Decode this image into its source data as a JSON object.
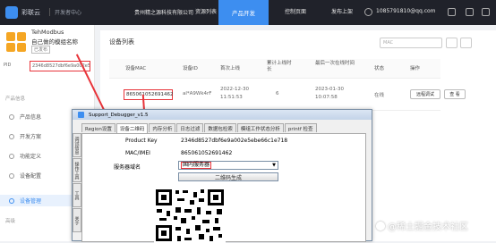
{
  "topbar": {
    "brand": "彩联云",
    "brand_sub": "开发者中心",
    "company": "贵州精之源科技有限公司",
    "company_nav": "资源列表",
    "nav_active": "产品开发",
    "nav_console": "控制页面",
    "nav_market": "发布上架",
    "user": "1085791810@qq.com"
  },
  "sidebar": {
    "product_name": "TehModbus",
    "product_name2": "自己做的模组名称",
    "product_tag": "已发布",
    "pid_label": "PID",
    "pid_value": "2346d8527dbf6e9a002e5ebe66c1e718",
    "group1": "产品信息",
    "items": [
      {
        "label": "产品信息"
      },
      {
        "label": "开发方案"
      },
      {
        "label": "功能定义"
      },
      {
        "label": "设备配置"
      },
      {
        "label": "设备管理"
      }
    ],
    "group2": "高级"
  },
  "main": {
    "title": "设备列表",
    "search_placeholder": "MAC",
    "columns": [
      "设备MAC",
      "设备ID",
      "首次上线",
      "累计上线时长",
      "最后一次在线时间",
      "状态",
      "操作"
    ],
    "row": {
      "mac": "865061052691462",
      "id": "al*A9Wk4rF",
      "first_online_date": "2022-12-30",
      "first_online_time": "11:51:53",
      "duration": "6",
      "last_online_date": "2023-01-30",
      "last_online_time": "10:07:58",
      "status": "在线",
      "btn_debug": "远程调试",
      "btn_detail": "查 看"
    }
  },
  "window": {
    "title": "Support_Debugger_v1.5",
    "tabs": [
      "Region设置",
      "设备二维码",
      "内存分析",
      "日志过滤",
      "数据包检索",
      "模组工作状态分析",
      "printf 检查"
    ],
    "active_tab": "设备二维码",
    "vtabs": [
      "调试信息",
      "操作工具",
      "工具",
      "关于"
    ],
    "product_key_label": "Product Key",
    "product_key_value": "2346d8527dbf6e9a002e5ebe66c1e718",
    "mac_label": "MAC/IMEI",
    "mac_value": "865061052691462",
    "server_label": "服务器域名",
    "server_value": "国内服务器",
    "gen_button": "二维码生成"
  },
  "watermark": "@稀土掘金技术社区",
  "colors": {
    "accent": "#3d8ef0",
    "highlight": "#e8343a",
    "topbar": "#20222a"
  }
}
